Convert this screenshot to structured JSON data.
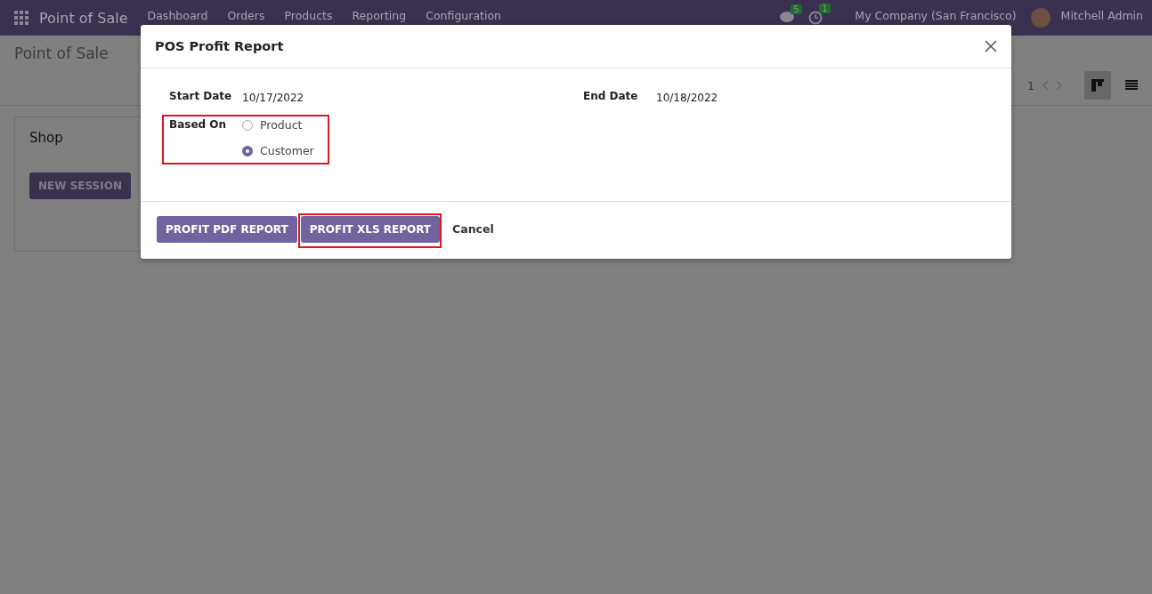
{
  "navbar": {
    "app_name": "Point of Sale",
    "menu": [
      "Dashboard",
      "Orders",
      "Products",
      "Reporting",
      "Configuration"
    ],
    "messages_count": "5",
    "activities_count": "1",
    "company": "My Company (San Francisco)",
    "user": "Mitchell Admin"
  },
  "control_panel": {
    "breadcrumb": "Point of Sale",
    "pager": "1",
    "views": [
      {
        "kind": "kanban",
        "selected": true
      },
      {
        "kind": "list",
        "selected": false
      }
    ]
  },
  "cards": [
    {
      "title": "Shop",
      "button": "NEW SESSION"
    }
  ],
  "dialog": {
    "title": "POS Profit Report",
    "start_date": {
      "label": "Start Date",
      "value": "10/17/2022"
    },
    "end_date": {
      "label": "End Date",
      "value": "10/18/2022"
    },
    "based_on": {
      "label": "Based On",
      "highlighted": true,
      "options": [
        {
          "label": "Product",
          "selected": false
        },
        {
          "label": "Customer",
          "selected": true
        }
      ]
    },
    "buttons": [
      {
        "label": "PROFIT PDF REPORT",
        "kind": "primary",
        "highlighted": false
      },
      {
        "label": "PROFIT XLS REPORT",
        "kind": "primary",
        "highlighted": true
      },
      {
        "label": "Cancel",
        "kind": "link",
        "highlighted": false
      }
    ]
  }
}
